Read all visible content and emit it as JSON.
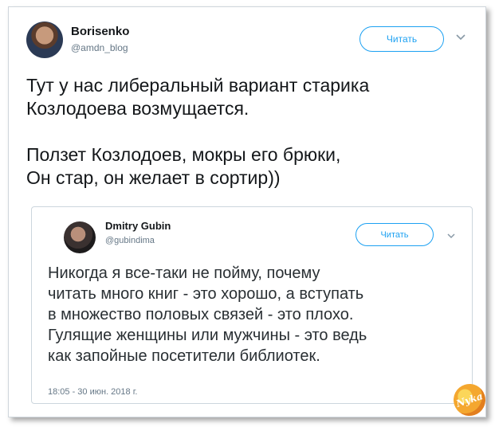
{
  "tweet": {
    "author_name": "Borisenko",
    "author_handle": "@amdn_blog",
    "follow_label": "Читать",
    "text": "Тут у нас либеральный вариант старика\nКозлодоева возмущается.\n\nПолзет Козлодоев, мокры его брюки,\nОн стар, он желает в сортир))"
  },
  "quoted_tweet": {
    "author_name": "Dmitry Gubin",
    "author_handle": "@gubindima",
    "follow_label": "Читать",
    "text": "Никогда я все-таки не пойму, почему\nчитать много книг - это хорошо, а вступать\nв множество половых связей - это плохо.\nГулящие женщины или мужчины - это ведь\nкак запойные посетители библиотек.",
    "timestamp": "18:05 - 30 июн. 2018 г."
  },
  "watermark": {
    "text": "Nyka"
  },
  "colors": {
    "accent": "#1da1f2",
    "text": "#14171a",
    "secondary": "#657786",
    "border": "#ccd6dd"
  }
}
